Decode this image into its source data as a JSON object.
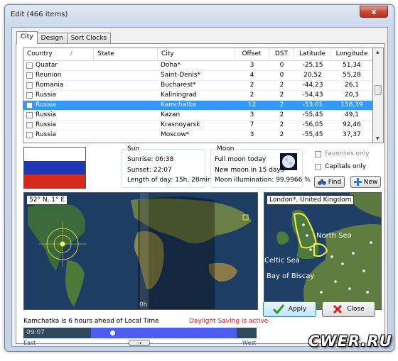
{
  "window": {
    "title": "Edit (466 items)",
    "close_glyph": "x"
  },
  "tabs": [
    {
      "label": "City"
    },
    {
      "label": "Design"
    },
    {
      "label": "Sort Clocks"
    }
  ],
  "grid": {
    "columns": {
      "country": "Country",
      "sort_glyph": "/",
      "state": "State",
      "city": "City",
      "offset": "Offset",
      "dst": "DST",
      "latitude": "Latitude",
      "longitude": "Longitude"
    },
    "rows": [
      {
        "country": "Quatar",
        "state": "",
        "city": "Doha*",
        "offset": "3",
        "dst": "0",
        "latitude": "-25,15",
        "longitude": "51,34"
      },
      {
        "country": "Reunion",
        "state": "",
        "city": "Saint-Denis*",
        "offset": "4",
        "dst": "0",
        "latitude": "20,52",
        "longitude": "55,28"
      },
      {
        "country": "Romania",
        "state": "",
        "city": "Bucharest*",
        "offset": "2",
        "dst": "2",
        "latitude": "-44,23",
        "longitude": "26,1"
      },
      {
        "country": "Russia",
        "state": "",
        "city": "Kaliningrad",
        "offset": "2",
        "dst": "2",
        "latitude": "-54,43",
        "longitude": "20,3"
      },
      {
        "country": "Russia",
        "state": "",
        "city": "Kamchatka",
        "offset": "12",
        "dst": "2",
        "latitude": "-53,01",
        "longitude": "158,39"
      },
      {
        "country": "Russia",
        "state": "",
        "city": "Kazan",
        "offset": "3",
        "dst": "2",
        "latitude": "-55,45",
        "longitude": "49,1"
      },
      {
        "country": "Russia",
        "state": "",
        "city": "Krasnoyarsk",
        "offset": "7",
        "dst": "2",
        "latitude": "-56,05",
        "longitude": "92,46"
      },
      {
        "country": "Russia",
        "state": "",
        "city": "Moscow*",
        "offset": "3",
        "dst": "2",
        "latitude": "-55,45",
        "longitude": "37,37"
      }
    ]
  },
  "sun": {
    "title": "Sun",
    "sunrise": "Sunrise:  06:38",
    "sunset": "Sunset:  22:07",
    "length": "Length of day: 15h, 28min"
  },
  "moon": {
    "title": "Moon",
    "line1": "Full moon today",
    "line2": "New moon in 15 days",
    "line3": "Moon illumination: 99,9966 %"
  },
  "options": {
    "favorites_only": "Favorites only",
    "capitals_only": "Capitals only"
  },
  "buttons": {
    "find": "Find",
    "new": "New",
    "apply": "Apply",
    "close": "Close"
  },
  "world_map": {
    "coords": "52° N, 1° E",
    "midnight": "0h"
  },
  "local_map": {
    "label": "London*, United Kingdom",
    "north_sea": "North Sea",
    "celtic_sea": "Celtic Sea",
    "bay_of_biscay": "Bay of Biscay"
  },
  "status": {
    "ahead": "Kamchatka is 6 hours ahead of Local Time",
    "dst": "Daylight Saving is active",
    "time": "09:07",
    "east": "East",
    "west": "West"
  },
  "colors": {
    "selected_row": "#3399ff",
    "dst_text": "#e02020",
    "timeline_day": "#4a5ef0",
    "timeline_night": "#2e4a5c",
    "flag_white": "#ffffff",
    "flag_blue": "#1c39b3",
    "flag_red": "#d52b1e"
  },
  "watermark": "CWER.RU"
}
